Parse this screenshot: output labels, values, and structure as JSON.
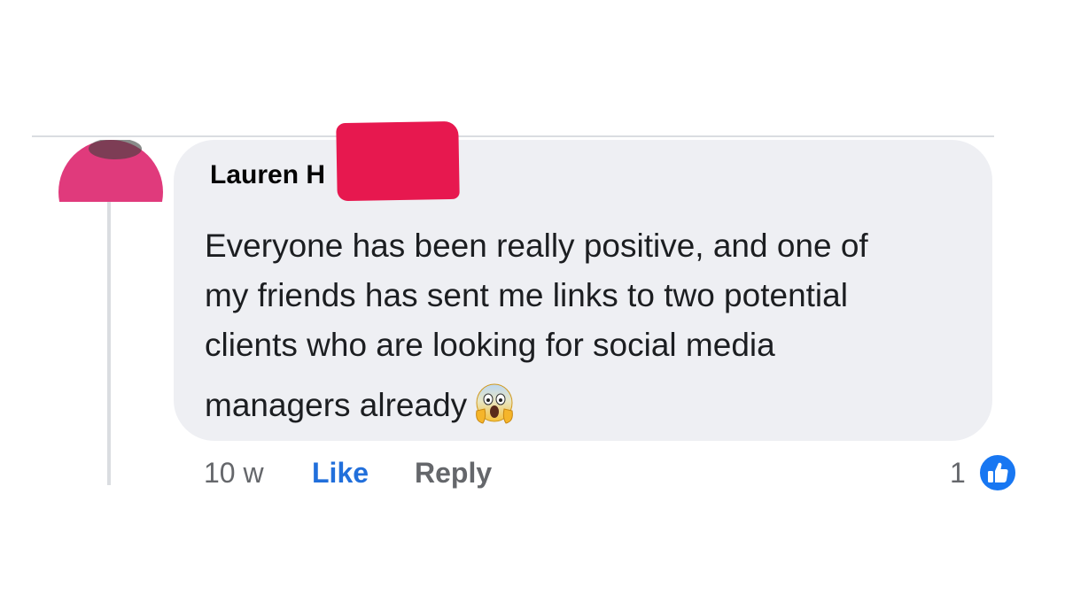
{
  "comment": {
    "author": "Lauren H",
    "text_lines": [
      "Everyone has been really positive, and one of",
      "my friends has sent me links to two potential",
      "clients who are looking for social media",
      "managers already"
    ],
    "emoji": "face-screaming-in-fear-emoji",
    "timestamp": "10 w",
    "like_label": "Like",
    "reply_label": "Reply",
    "reaction_count": "1",
    "reaction_icon": "like-icon"
  },
  "colors": {
    "bubble": "#eeeff3",
    "like_blue": "#216fdb",
    "muted_text": "#65676b",
    "redaction": "#e7184f",
    "avatar_redaction": "#e03a7c"
  }
}
